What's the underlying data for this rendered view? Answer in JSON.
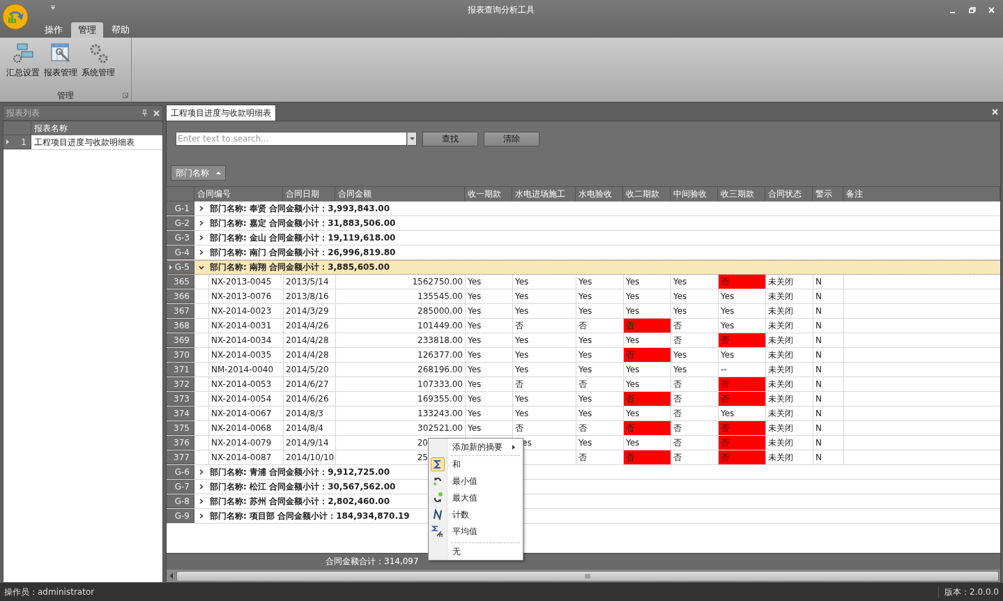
{
  "window": {
    "title": "报表查询分析工具"
  },
  "ribbon": {
    "tabs": [
      {
        "label": "操作",
        "selected": false
      },
      {
        "label": "管理",
        "selected": true
      },
      {
        "label": "帮助",
        "selected": false
      }
    ],
    "buttons": [
      {
        "label": "汇总设置",
        "kind": "summary"
      },
      {
        "label": "报表管理",
        "kind": "report"
      },
      {
        "label": "系统管理",
        "kind": "system"
      }
    ],
    "group_label": "管理"
  },
  "report_list": {
    "title": "报表列表",
    "column": "报表名称",
    "rows": [
      {
        "number": "1",
        "name": "工程项目进度与收款明细表",
        "selected": true
      }
    ]
  },
  "document_tab": {
    "label": "工程项目进度与收款明细表"
  },
  "search": {
    "placeholder": "Enter text to search...",
    "buttons": [
      "查找",
      "清除"
    ]
  },
  "group_panel": {
    "chip": "部门名称"
  },
  "grid": {
    "columns": [
      "合同编号",
      "合同日期",
      "合同金额",
      "收一期款",
      "水电进场施工",
      "水电验收",
      "收二期款",
      "中间验收",
      "收三期款",
      "合同状态",
      "警示",
      "备注"
    ],
    "groups": [
      {
        "label": "G-1",
        "text": "部门名称: 奉贤 合同金额小计：3,993,843.00",
        "expanded": false,
        "selected": false
      },
      {
        "label": "G-2",
        "text": "部门名称: 嘉定 合同金额小计：31,883,506.00",
        "expanded": false,
        "selected": false
      },
      {
        "label": "G-3",
        "text": "部门名称: 金山 合同金额小计：19,119,618.00",
        "expanded": false,
        "selected": false
      },
      {
        "label": "G-4",
        "text": "部门名称: 南门 合同金额小计：26,996,819.80",
        "expanded": false,
        "selected": false
      },
      {
        "label": "G-5",
        "text": "部门名称: 南翔 合同金额小计：3,885,605.00",
        "expanded": true,
        "selected": true,
        "rows": [
          {
            "number": "365",
            "cells": [
              "NX-2013-0045",
              "2013/5/14",
              "1562750.00",
              "Yes",
              "Yes",
              "Yes",
              "Yes",
              "Yes",
              "否",
              "未关闭",
              "N"
            ],
            "pay2_alert": false,
            "pay3_alert": true,
            "covered": false
          },
          {
            "number": "366",
            "cells": [
              "NX-2013-0076",
              "2013/8/16",
              "135545.00",
              "Yes",
              "Yes",
              "Yes",
              "Yes",
              "Yes",
              "Yes",
              "未关闭",
              "N"
            ],
            "pay2_alert": false,
            "pay3_alert": false,
            "covered": false
          },
          {
            "number": "367",
            "cells": [
              "NX-2014-0023",
              "2014/3/29",
              "285000.00",
              "Yes",
              "Yes",
              "Yes",
              "Yes",
              "Yes",
              "Yes",
              "未关闭",
              "N"
            ],
            "pay2_alert": false,
            "pay3_alert": false,
            "covered": false
          },
          {
            "number": "368",
            "cells": [
              "NX-2014-0031",
              "2014/4/26",
              "101449.00",
              "Yes",
              "否",
              "否",
              "否",
              "否",
              "Yes",
              "未关闭",
              "N"
            ],
            "pay2_alert": true,
            "pay3_alert": false,
            "covered": false
          },
          {
            "number": "369",
            "cells": [
              "NX-2014-0034",
              "2014/4/28",
              "233818.00",
              "Yes",
              "Yes",
              "Yes",
              "Yes",
              "否",
              "否",
              "未关闭",
              "N"
            ],
            "pay2_alert": false,
            "pay3_alert": true,
            "covered": false
          },
          {
            "number": "370",
            "cells": [
              "NX-2014-0035",
              "2014/4/28",
              "126377.00",
              "Yes",
              "Yes",
              "Yes",
              "否",
              "Yes",
              "Yes",
              "未关闭",
              "N"
            ],
            "pay2_alert": true,
            "pay3_alert": false,
            "covered": false
          },
          {
            "number": "371",
            "cells": [
              "NM-2014-0040",
              "2014/5/20",
              "268196.00",
              "Yes",
              "Yes",
              "Yes",
              "Yes",
              "Yes",
              "--",
              "未关闭",
              "N"
            ],
            "pay2_alert": false,
            "pay3_alert": false,
            "covered": false
          },
          {
            "number": "372",
            "cells": [
              "NX-2014-0053",
              "2014/6/27",
              "107333.00",
              "Yes",
              "否",
              "否",
              "Yes",
              "否",
              "否",
              "未关闭",
              "N"
            ],
            "pay2_alert": false,
            "pay3_alert": true,
            "covered": false
          },
          {
            "number": "373",
            "cells": [
              "NX-2014-0054",
              "2014/6/26",
              "169355.00",
              "Yes",
              "Yes",
              "Yes",
              "否",
              "否",
              "否",
              "未关闭",
              "N"
            ],
            "pay2_alert": true,
            "pay3_alert": true,
            "covered": false
          },
          {
            "number": "374",
            "cells": [
              "NX-2014-0067",
              "2014/8/3",
              "133243.00",
              "Yes",
              "Yes",
              "Yes",
              "Yes",
              "否",
              "Yes",
              "未关闭",
              "N"
            ],
            "pay2_alert": false,
            "pay3_alert": false,
            "covered": false
          },
          {
            "number": "375",
            "cells": [
              "NX-2014-0068",
              "2014/8/4",
              "302521.00",
              "Yes",
              "否",
              "否",
              "否",
              "否",
              "否",
              "未关闭",
              "N"
            ],
            "pay2_alert": true,
            "pay3_alert": true,
            "covered": false
          },
          {
            "number": "376",
            "cells": [
              "NX-2014-0079",
              "2014/9/14",
              "20",
              null,
              "es",
              "Yes",
              "Yes",
              "否",
              "否",
              "未关闭",
              "N"
            ],
            "pay2_alert": false,
            "pay3_alert": true,
            "covered": true
          },
          {
            "number": "377",
            "cells": [
              "NX-2014-0087",
              "2014/10/10",
              "25",
              null,
              null,
              "否",
              "否",
              "否",
              "否",
              "未关闭",
              "N"
            ],
            "pay2_alert": true,
            "pay3_alert": true,
            "covered": true
          }
        ]
      },
      {
        "label": "G-6",
        "text": "部门名称: 青浦 合同金额小计：9,912,725.00",
        "expanded": false,
        "selected": false
      },
      {
        "label": "G-7",
        "text": "部门名称: 松江 合同金额小计：30,567,562.00",
        "expanded": false,
        "selected": false
      },
      {
        "label": "G-8",
        "text": "部门名称: 苏州 合同金额小计：2,802,460.00",
        "expanded": false,
        "selected": false
      },
      {
        "label": "G-9",
        "text": "部门名称: 项目部 合同金额小计：184,934,870.19",
        "expanded": false,
        "selected": false
      }
    ]
  },
  "footer": {
    "total": "合同金额合计：314,097"
  },
  "context_menu": {
    "header": "添加新的摘要",
    "items": [
      {
        "kind": "sum",
        "label": "和",
        "selected": true
      },
      {
        "kind": "min",
        "label": "最小值",
        "selected": false
      },
      {
        "kind": "max",
        "label": "最大值",
        "selected": false
      },
      {
        "kind": "count",
        "label": "计数",
        "selected": false
      },
      {
        "kind": "average",
        "label": "平均值",
        "selected": false
      },
      {
        "kind": "none",
        "label": "无",
        "selected": false
      }
    ]
  },
  "status_bar": {
    "operator": "操作员：administrator",
    "version": "版本：2.0.0.0"
  }
}
